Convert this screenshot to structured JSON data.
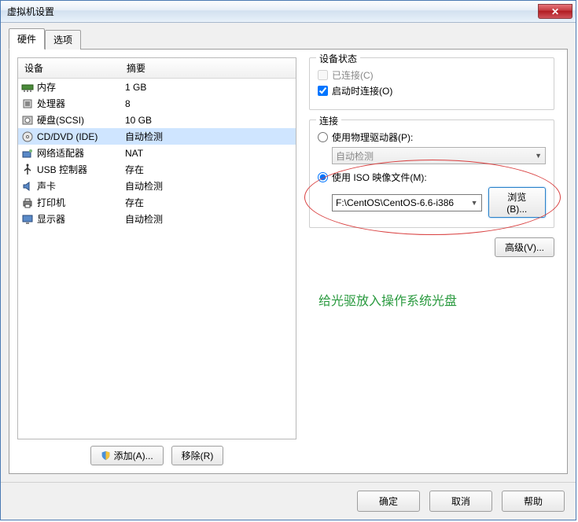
{
  "window": {
    "title": "虚拟机设置"
  },
  "tabs": {
    "hardware": "硬件",
    "options": "选项"
  },
  "device_headers": {
    "device": "设备",
    "summary": "摘要"
  },
  "devices": [
    {
      "name": "内存",
      "summary": "1 GB",
      "icon": "memory"
    },
    {
      "name": "处理器",
      "summary": "8",
      "icon": "cpu"
    },
    {
      "name": "硬盘(SCSI)",
      "summary": "10 GB",
      "icon": "hdd"
    },
    {
      "name": "CD/DVD (IDE)",
      "summary": "自动检测",
      "icon": "cd",
      "selected": true
    },
    {
      "name": "网络适配器",
      "summary": "NAT",
      "icon": "net"
    },
    {
      "name": "USB 控制器",
      "summary": "存在",
      "icon": "usb"
    },
    {
      "name": "声卡",
      "summary": "自动检测",
      "icon": "sound"
    },
    {
      "name": "打印机",
      "summary": "存在",
      "icon": "printer"
    },
    {
      "name": "显示器",
      "summary": "自动检测",
      "icon": "display"
    }
  ],
  "buttons": {
    "add": "添加(A)...",
    "remove": "移除(R)",
    "browse": "浏览(B)...",
    "advanced": "高级(V)...",
    "ok": "确定",
    "cancel": "取消",
    "help": "帮助"
  },
  "right": {
    "status_title": "设备状态",
    "connected": "已连接(C)",
    "connect_at_power": "启动时连接(O)",
    "connection_title": "连接",
    "use_physical": "使用物理驱动器(P):",
    "auto_detect": "自动检测",
    "use_iso": "使用 ISO 映像文件(M):",
    "iso_path": "F:\\CentOS\\CentOS-6.6-i386"
  },
  "annotation": "给光驱放入操作系统光盘"
}
